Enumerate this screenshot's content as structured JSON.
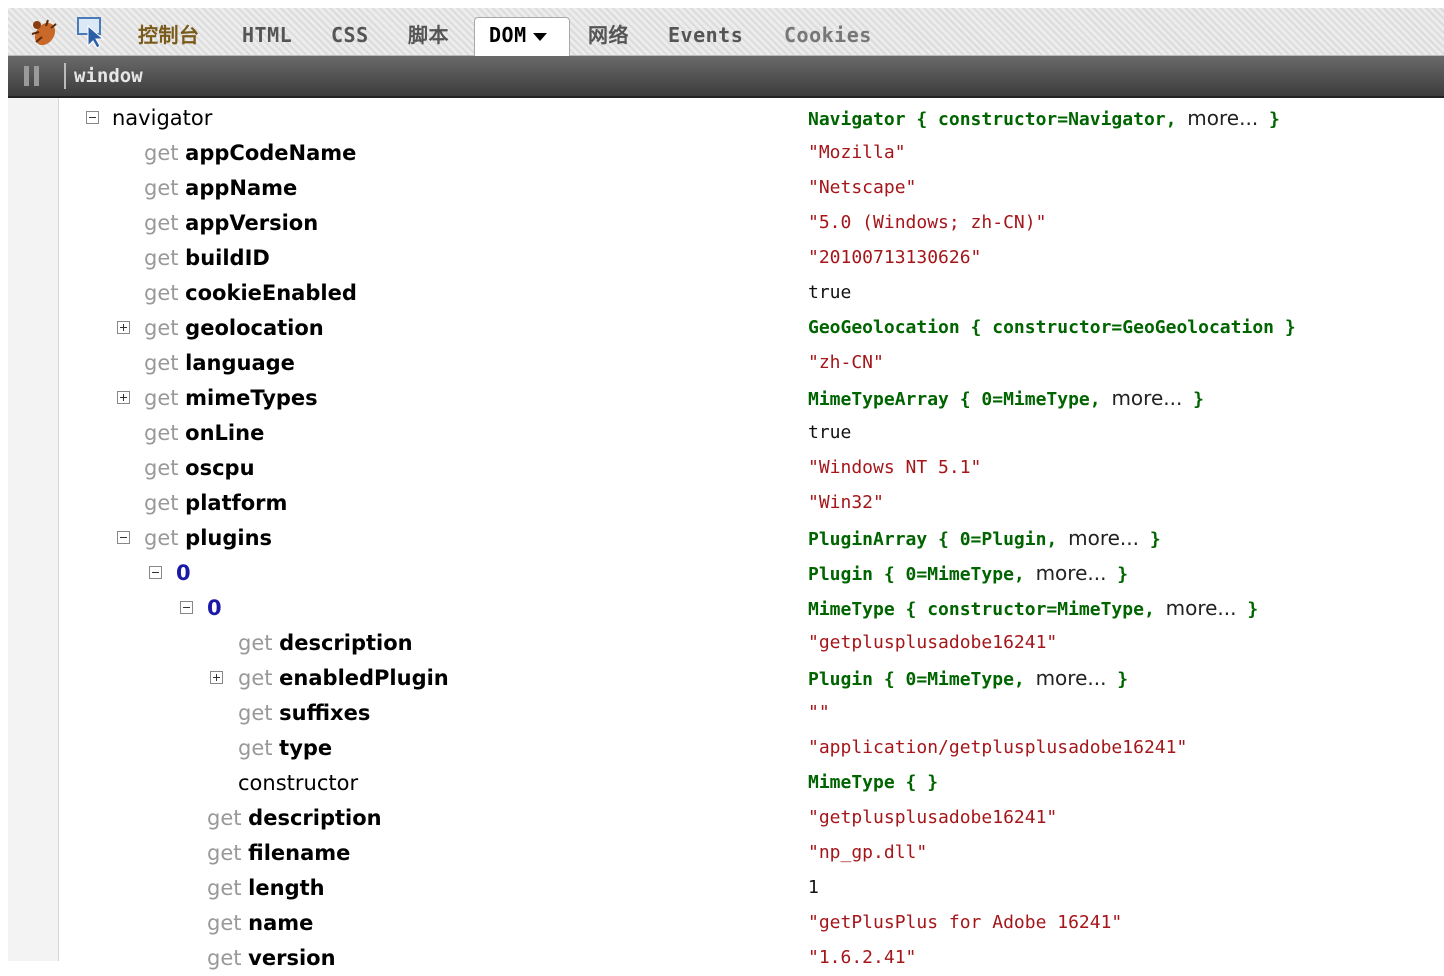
{
  "toolbar": {
    "tabs": [
      "控制台",
      "HTML",
      "CSS",
      "脚本",
      "DOM",
      "网络",
      "Events",
      "Cookies"
    ]
  },
  "breadcrumb": {
    "path": "window"
  },
  "dom": {
    "rows": [
      {
        "get": "",
        "name": "navigator",
        "value": "Navigator { constructor=Navigator, ",
        "more": "more...",
        "close": " }"
      },
      {
        "get": "get",
        "name": "appCodeName",
        "value": "\"Mozilla\""
      },
      {
        "get": "get",
        "name": "appName",
        "value": "\"Netscape\""
      },
      {
        "get": "get",
        "name": "appVersion",
        "value": "\"5.0 (Windows; zh-CN)\""
      },
      {
        "get": "get",
        "name": "buildID",
        "value": "\"20100713130626\""
      },
      {
        "get": "get",
        "name": "cookieEnabled",
        "value": "true"
      },
      {
        "get": "get",
        "name": "geolocation",
        "value": "GeoGeolocation { constructor=GeoGeolocation }"
      },
      {
        "get": "get",
        "name": "language",
        "value": "\"zh-CN\""
      },
      {
        "get": "get",
        "name": "mimeTypes",
        "value": "MimeTypeArray { 0=MimeType, ",
        "more": "more...",
        "close": " }"
      },
      {
        "get": "get",
        "name": "onLine",
        "value": "true"
      },
      {
        "get": "get",
        "name": "oscpu",
        "value": "\"Windows NT 5.1\""
      },
      {
        "get": "get",
        "name": "platform",
        "value": "\"Win32\""
      },
      {
        "get": "get",
        "name": "plugins",
        "value": "PluginArray { 0=Plugin, ",
        "more": "more...",
        "close": " }"
      },
      {
        "get": "",
        "name": "0",
        "value": "Plugin { 0=MimeType, ",
        "more": "more...",
        "close": " }"
      },
      {
        "get": "",
        "name": "0",
        "value": "MimeType { constructor=MimeType, ",
        "more": "more...",
        "close": " }"
      },
      {
        "get": "get",
        "name": "description",
        "value": "\"getplusplusadobe16241\""
      },
      {
        "get": "get",
        "name": "enabledPlugin",
        "value": "Plugin { 0=MimeType, ",
        "more": "more...",
        "close": " }"
      },
      {
        "get": "get",
        "name": "suffixes",
        "value": "\"\""
      },
      {
        "get": "get",
        "name": "type",
        "value": "\"application/getplusplusadobe16241\""
      },
      {
        "get": "",
        "name": "constructor",
        "value": "MimeType { }"
      },
      {
        "get": "get",
        "name": "description",
        "value": "\"getplusplusadobe16241\""
      },
      {
        "get": "get",
        "name": "filename",
        "value": "\"np_gp.dll\""
      },
      {
        "get": "get",
        "name": "length",
        "value": "1"
      },
      {
        "get": "get",
        "name": "name",
        "value": "\"getPlusPlus for Adobe 16241\""
      },
      {
        "get": "get",
        "name": "version",
        "value": "\"1.6.2.41\""
      }
    ]
  },
  "colors": {
    "object_value": "#006400",
    "string_value": "#a4161a",
    "getter_prefix": "#999999",
    "index_name": "#1a1aa6"
  }
}
